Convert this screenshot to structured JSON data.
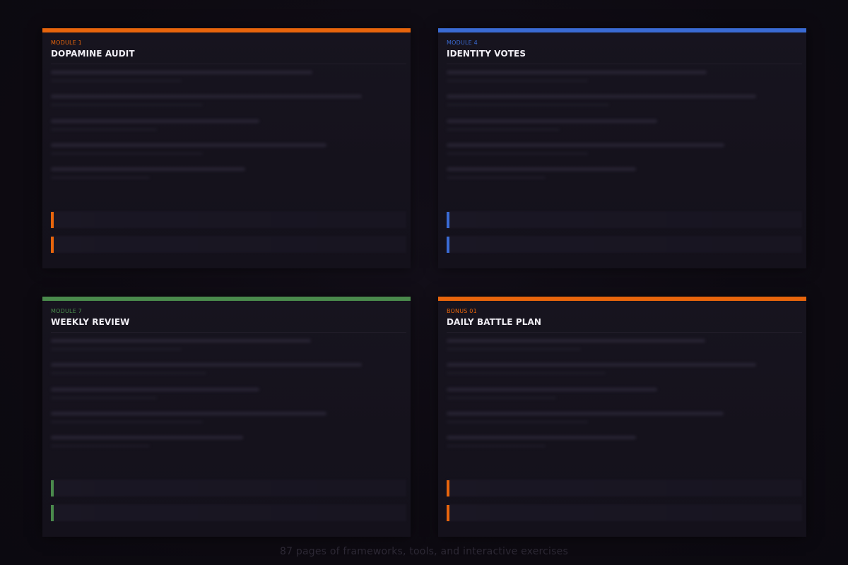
{
  "cards": [
    {
      "label": "MODULE 1",
      "title": "DOPAMINE AUDIT",
      "accent": "#e8650c"
    },
    {
      "label": "MODULE 4",
      "title": "IDENTITY VOTES",
      "accent": "#3a6bd4"
    },
    {
      "label": "MODULE 7",
      "title": "WEEKLY REVIEW",
      "accent": "#4a8a4c"
    },
    {
      "label": "BONUS 01",
      "title": "DAILY BATTLE PLAN",
      "accent": "#e8650c"
    }
  ],
  "footer": {
    "text": "87 pages of frameworks, tools, and interactive exercises"
  }
}
